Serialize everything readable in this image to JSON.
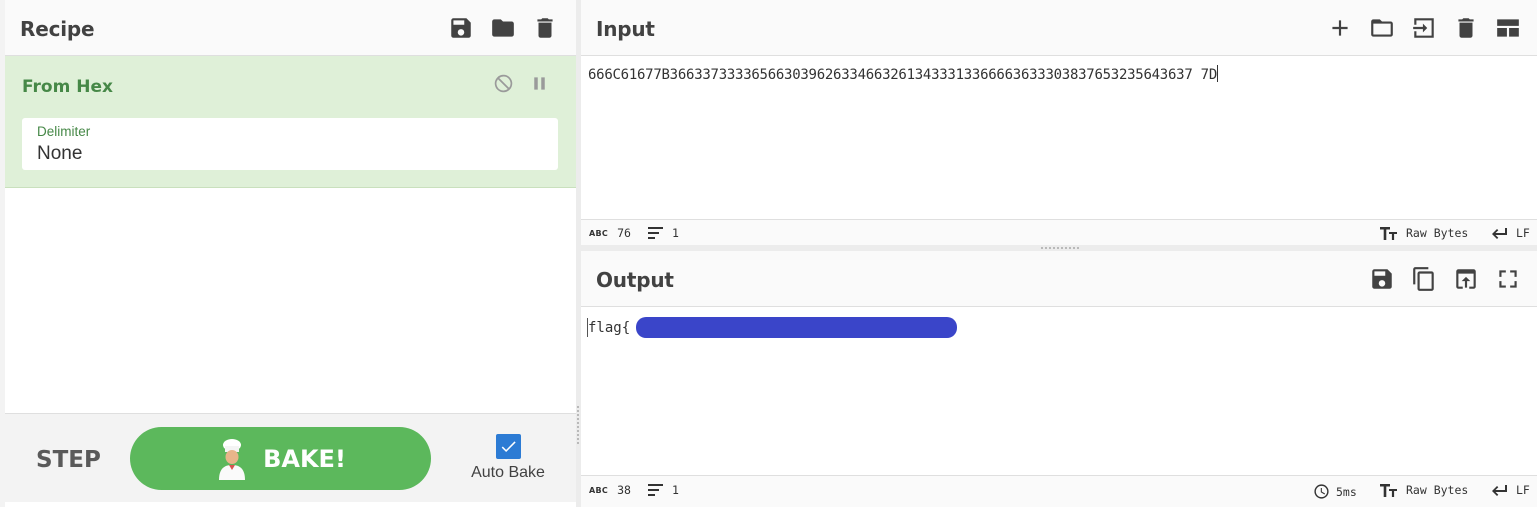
{
  "recipe": {
    "title": "Recipe",
    "header_icons": [
      "save-icon",
      "folder-icon",
      "trash-icon"
    ],
    "operation": {
      "name": "From Hex",
      "controls": [
        "disable-icon",
        "breakpoint-icon"
      ],
      "argument": {
        "label": "Delimiter",
        "value": "None"
      }
    },
    "footer": {
      "step_label": "STEP",
      "bake_label": "BAKE!",
      "auto_bake_label": "Auto Bake",
      "auto_bake_checked": true
    }
  },
  "input": {
    "title": "Input",
    "header_icons": [
      "plus-icon",
      "folder-icon",
      "import-icon",
      "trash-icon",
      "layout-icon"
    ],
    "text": "666C61677B3663373333656630396263346632613433313366663633303837653235643637 7D",
    "status": {
      "length": "76",
      "lines": "1",
      "encoding": "Raw Bytes",
      "eol": "LF"
    }
  },
  "output": {
    "title": "Output",
    "header_icons": [
      "save-icon",
      "copy-icon",
      "replace-input-icon",
      "maximize-icon"
    ],
    "text": "flag{",
    "status": {
      "length": "38",
      "lines": "1",
      "time": "5ms",
      "encoding": "Raw Bytes",
      "eol": "LF"
    }
  },
  "colors": {
    "operation_bg": "#dff0d8",
    "operation_text": "#468847",
    "bake_button": "#5cb85c",
    "checkbox": "#2c7bd4",
    "redaction": "#3a45c9"
  }
}
